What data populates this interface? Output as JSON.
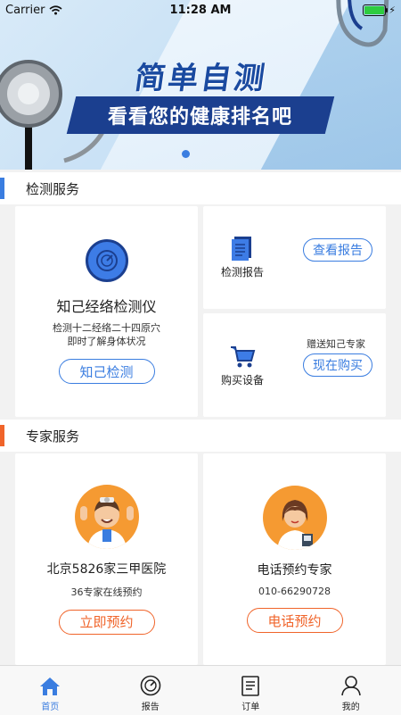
{
  "status_bar": {
    "carrier": "Carrier",
    "time": "11:28 AM"
  },
  "banner": {
    "title": "简单自测",
    "subtitle": "看看您的健康排名吧"
  },
  "sections": {
    "detection": {
      "title": "检测服务",
      "accent": "#3a7de0"
    },
    "expert": {
      "title": "专家服务",
      "accent": "#f0642a"
    }
  },
  "device_card": {
    "title": "知己经络检测仪",
    "desc_line1": "检测十二经络二十四原穴",
    "desc_line2": "即时了解身体状况",
    "button": "知己检测"
  },
  "report_card": {
    "label": "检测报告",
    "button": "查看报告"
  },
  "buy_card": {
    "label": "购买设备",
    "note": "赠送知己专家",
    "button": "现在购买"
  },
  "hospital_card": {
    "title": "北京5826家三甲医院",
    "sub": "36专家在线预约",
    "button": "立即预约"
  },
  "phone_card": {
    "title": "电话预约专家",
    "phone": "010-66290728",
    "button": "电话预约"
  },
  "tabs": [
    {
      "label": "首页",
      "icon": "home-icon",
      "active": true
    },
    {
      "label": "报告",
      "icon": "report-icon",
      "active": false
    },
    {
      "label": "订单",
      "icon": "order-icon",
      "active": false
    },
    {
      "label": "我的",
      "icon": "profile-icon",
      "active": false
    }
  ],
  "colors": {
    "primary": "#3a7de0",
    "orange": "#f0642a",
    "banner_navy": "#1b3f8f"
  }
}
